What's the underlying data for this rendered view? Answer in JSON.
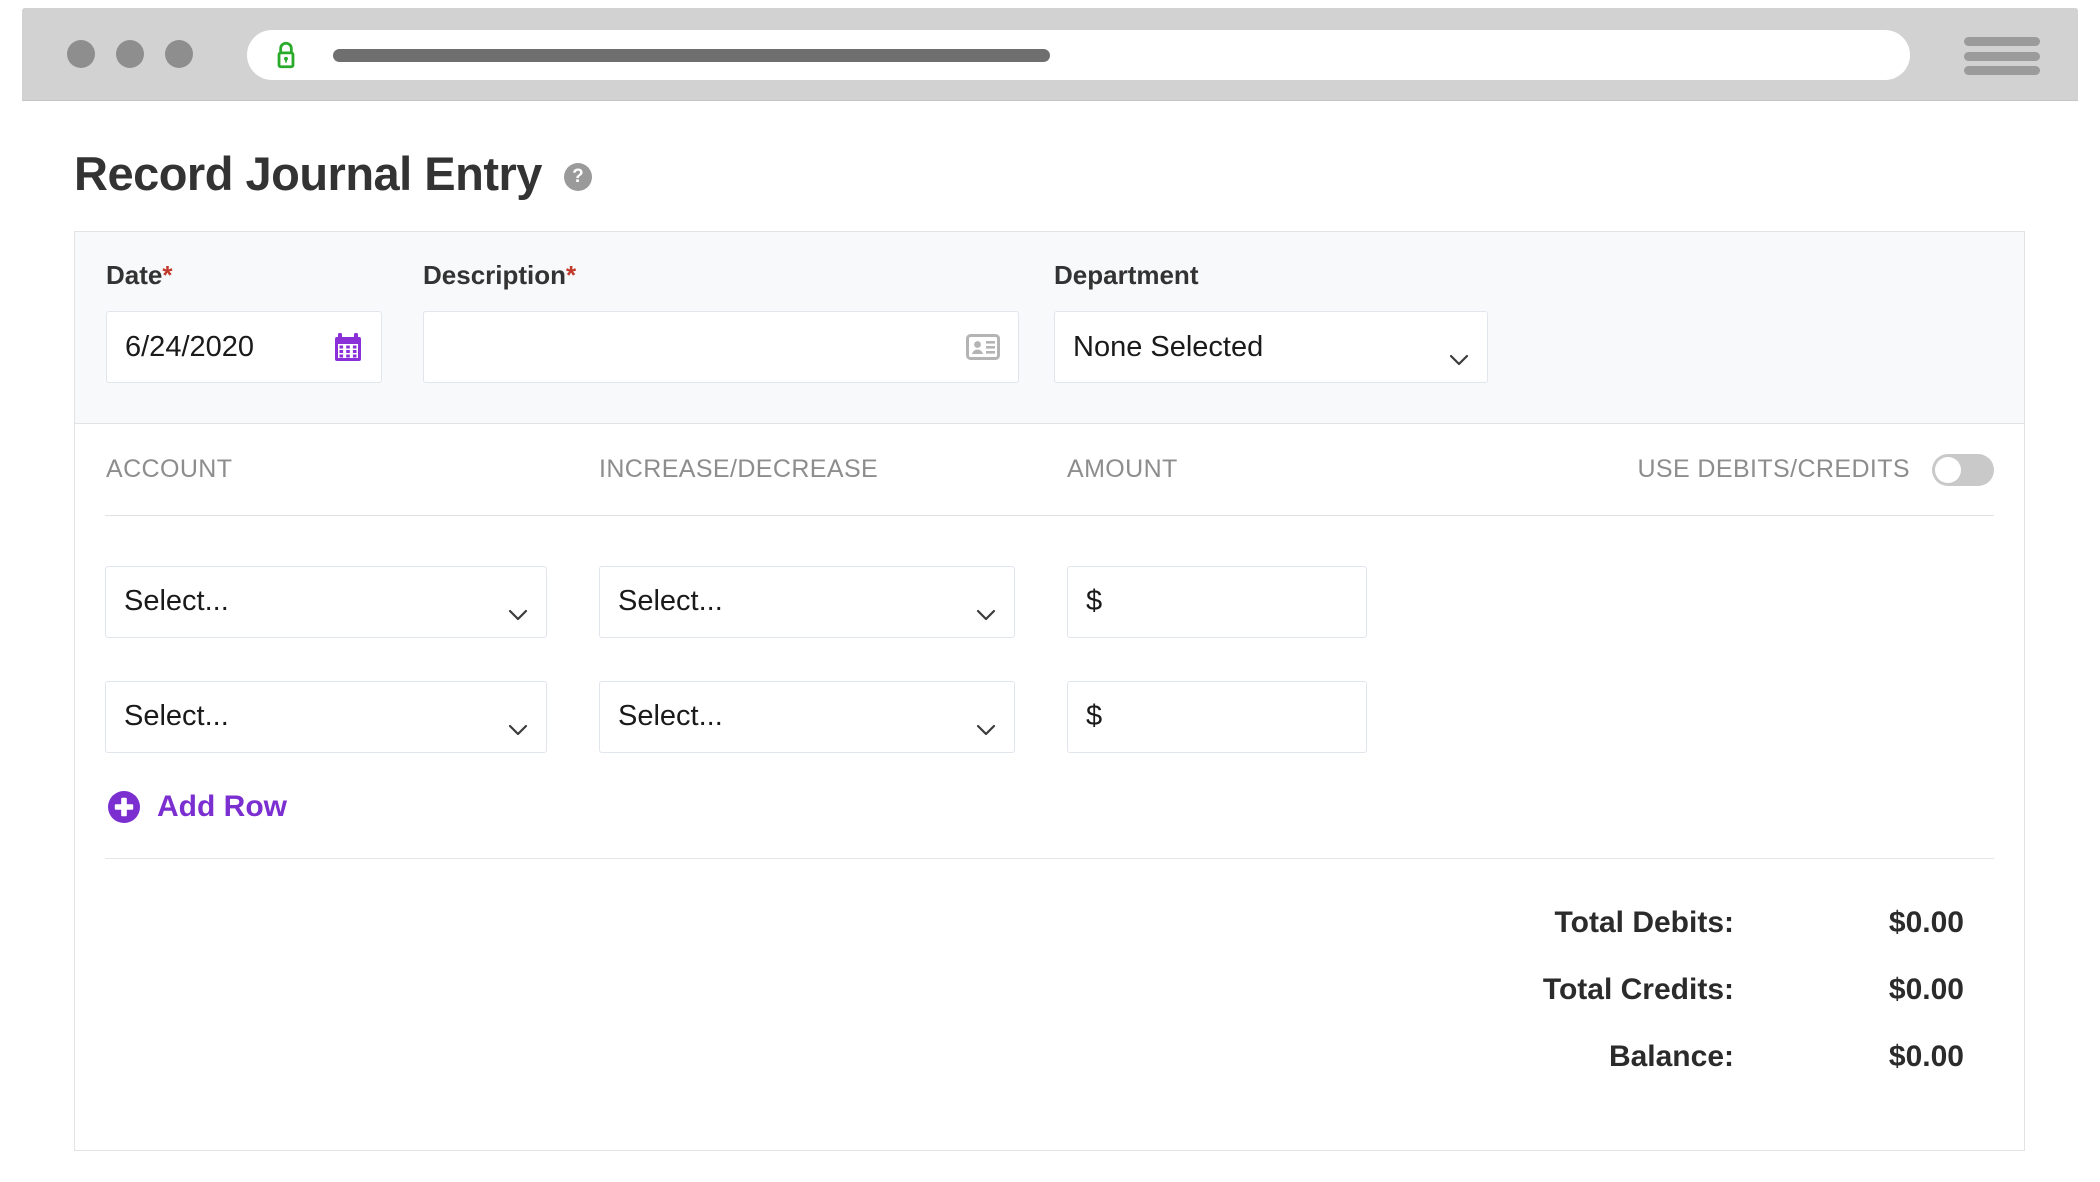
{
  "browser": {
    "lock_icon": "lock-icon",
    "menu_icon": "hamburger-menu-icon",
    "url_value": ""
  },
  "page": {
    "title": "Record Journal Entry",
    "help_icon_glyph": "?"
  },
  "header_form": {
    "date": {
      "label": "Date",
      "required_marker": "*",
      "value": "6/24/2020",
      "icon": "calendar-icon"
    },
    "description": {
      "label": "Description",
      "required_marker": "*",
      "value": "",
      "placeholder": "",
      "icon": "contact-card-icon"
    },
    "department": {
      "label": "Department",
      "required_marker": "",
      "value": "None Selected",
      "icon": "chevron-down-icon"
    }
  },
  "lines_table": {
    "columns": {
      "account": "ACCOUNT",
      "increase_decrease": "INCREASE/DECREASE",
      "amount": "AMOUNT"
    },
    "toggle": {
      "label": "USE DEBITS/CREDITS",
      "state": "off"
    },
    "rows": [
      {
        "account": "Select...",
        "increase_decrease": "Select...",
        "amount_prefix": "$",
        "amount": ""
      },
      {
        "account": "Select...",
        "increase_decrease": "Select...",
        "amount_prefix": "$",
        "amount": ""
      }
    ],
    "add_row_label": "Add Row",
    "add_row_icon": "plus-circle-icon"
  },
  "totals": [
    {
      "label": "Total Debits:",
      "value": "$0.00"
    },
    {
      "label": "Total Credits:",
      "value": "$0.00"
    },
    {
      "label": "Balance:",
      "value": "$0.00"
    }
  ],
  "colors": {
    "accent_purple": "#7b2fd0",
    "required_red": "#c0392b",
    "lock_green": "#2aaa2a",
    "chrome_gray": "#d2d2d2",
    "panel_bg": "#f8f9fa"
  }
}
